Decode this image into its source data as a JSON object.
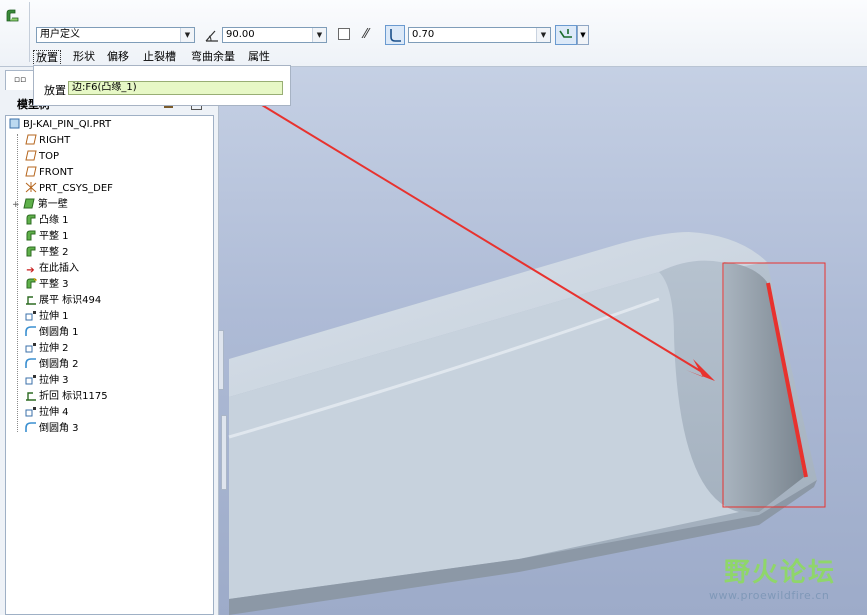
{
  "dashboard": {
    "bend_type": "用户定义",
    "angle": "90.00",
    "radius": "0.70",
    "tabs": [
      "放置",
      "形状",
      "偏移",
      "止裂槽",
      "弯曲余量",
      "属性"
    ]
  },
  "placement": {
    "label": "放置",
    "reference": "边:F6(凸缘_1)"
  },
  "model_tree": {
    "header": "模型树",
    "items": [
      {
        "label": "BJ-KAI_PIN_QI.PRT",
        "icon": "part-icon"
      },
      {
        "label": "RIGHT",
        "icon": "datum-plane-icon"
      },
      {
        "label": "TOP",
        "icon": "datum-plane-icon"
      },
      {
        "label": "FRONT",
        "icon": "datum-plane-icon"
      },
      {
        "label": "PRT_CSYS_DEF",
        "icon": "csys-icon"
      },
      {
        "label": "第一壁",
        "icon": "wall-icon"
      },
      {
        "label": "凸缘 1",
        "icon": "flange-icon"
      },
      {
        "label": "平整 1",
        "icon": "flat-wall-icon"
      },
      {
        "label": "平整 2",
        "icon": "flat-wall-icon"
      },
      {
        "label": "在此插入",
        "icon": "insert-here-icon"
      },
      {
        "label": "平整 3",
        "icon": "flat-wall-icon"
      },
      {
        "label": "展平 标识494",
        "icon": "unbend-icon"
      },
      {
        "label": "拉伸 1",
        "icon": "extrude-icon"
      },
      {
        "label": "倒圆角 1",
        "icon": "round-icon"
      },
      {
        "label": "拉伸 2",
        "icon": "extrude-icon"
      },
      {
        "label": "倒圆角 2",
        "icon": "round-icon"
      },
      {
        "label": "拉伸 3",
        "icon": "extrude-icon"
      },
      {
        "label": "折回 标识1175",
        "icon": "bend-back-icon"
      },
      {
        "label": "拉伸 4",
        "icon": "extrude-icon"
      },
      {
        "label": "倒圆角 3",
        "icon": "round-icon"
      }
    ]
  },
  "colors": {
    "annotation_red": "#e8322e",
    "placement_field_bg": "#e7f8c6",
    "viewport_bg": "#aebbd6"
  },
  "watermark": {
    "title": "野火论坛",
    "url": "www.proewildfire.cn"
  }
}
